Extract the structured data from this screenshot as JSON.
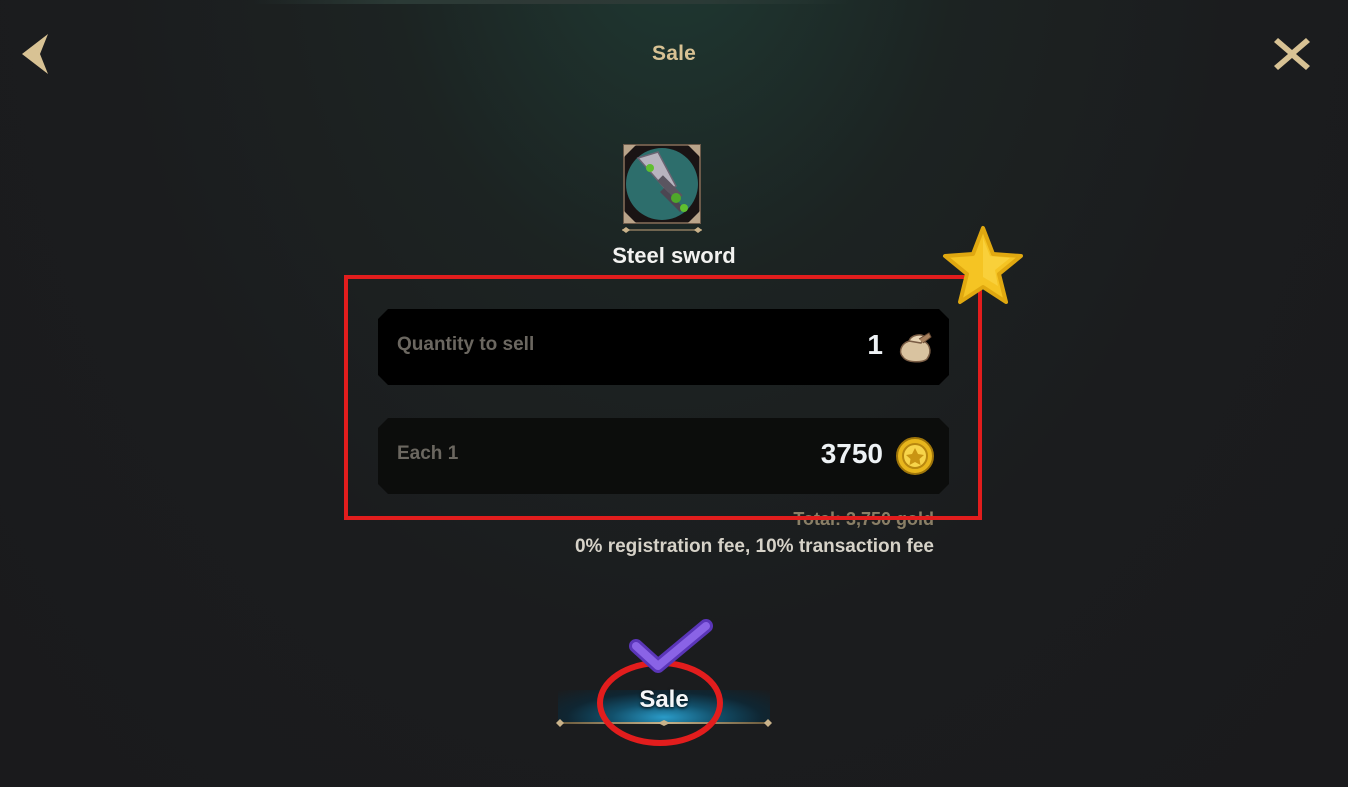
{
  "header": {
    "title": "Sale",
    "back_icon": "chevron-left-icon",
    "close_icon": "close-icon"
  },
  "item": {
    "name": "Steel sword",
    "icon": "sword-icon"
  },
  "quantity": {
    "label": "Quantity to sell",
    "value": "1",
    "icon": "bag-icon"
  },
  "price": {
    "label": "Each 1",
    "value": "3750",
    "icon": "gold-coin-icon"
  },
  "summary": {
    "total": "Total: 3,750 gold",
    "fees": "0% registration fee, 10% transaction fee"
  },
  "actions": {
    "sale_label": "Sale"
  },
  "annotations": {
    "box_color": "#e21d1d",
    "circle_color": "#e21d1d",
    "check_color": "#7a4fd8",
    "star_color": "#f5c423"
  },
  "colors": {
    "title": "#d8c294",
    "accent_blue": "#2a9bc8"
  }
}
